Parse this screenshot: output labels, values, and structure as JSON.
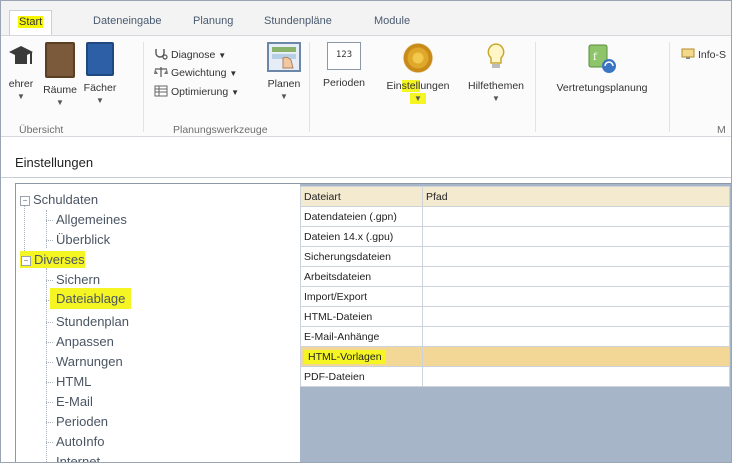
{
  "tabs": {
    "start": "Start",
    "dateneingabe": "Dateneingabe",
    "planung": "Planung",
    "stundenplaene": "Stundenpläne",
    "module": "Module"
  },
  "ribbon": {
    "buttons": {
      "lehrer": "ehrer",
      "raeume": "Räume",
      "faecher": "Fächer",
      "planen": "Planen",
      "perioden": "Perioden",
      "einstellungen": "Einstellungen",
      "hilfethemen": "Hilfethemen",
      "vertretungsplanung": "Vertretungsplanung",
      "info": "Info-S"
    },
    "planung_items": {
      "diagnose": "Diagnose",
      "gewichtung": "Gewichtung",
      "optimierung": "Optimierung"
    },
    "perioden_icon_text": "123",
    "group_labels": {
      "uebersicht": "Übersicht",
      "planungswerkzeuge": "Planungswerkzeuge",
      "more": "M"
    }
  },
  "section": {
    "title": "Einstellungen"
  },
  "tree": {
    "schuldaten": "Schuldaten",
    "allgemeines": "Allgemeines",
    "ueberblick": "Überblick",
    "diverses": "Diverses",
    "sichern": "Sichern",
    "dateiablage": "Dateiablage",
    "stundenplan": "Stundenplan",
    "anpassen": "Anpassen",
    "warnungen": "Warnungen",
    "html": "HTML",
    "email": "E-Mail",
    "perioden": "Perioden",
    "autoinfo": "AutoInfo",
    "internet": "Internet"
  },
  "grid": {
    "headers": {
      "dateiart": "Dateiart",
      "pfad": "Pfad"
    },
    "rows": [
      {
        "dateiart": "Datendateien (.gpn)",
        "pfad": ""
      },
      {
        "dateiart": "Dateien 14.x (.gpu)",
        "pfad": ""
      },
      {
        "dateiart": "Sicherungsdateien",
        "pfad": ""
      },
      {
        "dateiart": "Arbeitsdateien",
        "pfad": ""
      },
      {
        "dateiart": "Import/Export",
        "pfad": ""
      },
      {
        "dateiart": "HTML-Dateien",
        "pfad": ""
      },
      {
        "dateiart": "E-Mail-Anhänge",
        "pfad": ""
      },
      {
        "dateiart": "HTML-Vorlagen",
        "pfad": ""
      },
      {
        "dateiart": "PDF-Dateien",
        "pfad": ""
      }
    ]
  },
  "colors": {
    "highlight": "#f5f523",
    "selected_row": "#f3d796",
    "grid_header": "#f3ead0",
    "grid_background": "#a6b5c7"
  }
}
